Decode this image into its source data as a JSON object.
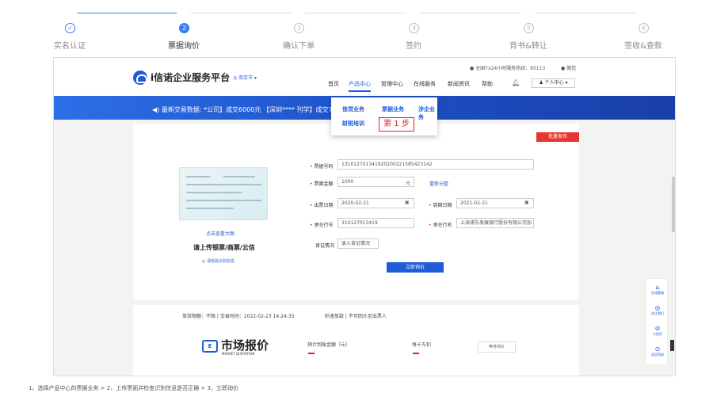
{
  "steps": [
    {
      "num": "✓",
      "label": "实名认证"
    },
    {
      "num": "2",
      "label": "票据询价"
    },
    {
      "num": "3",
      "label": "确认下单"
    },
    {
      "num": "4",
      "label": "签约"
    },
    {
      "num": "5",
      "label": "背书&转让"
    },
    {
      "num": "6",
      "label": "签收&查款"
    }
  ],
  "header": {
    "brand": "i信诺企业服务平台",
    "city": "◎ 南京市 ▾",
    "hotline": "● 全国7x24小时服务热线：95113",
    "wechat": "● 微信",
    "nav": [
      "首页",
      "产品中心",
      "管理中心",
      "在线服务",
      "新闻资讯",
      "帮助"
    ],
    "user": "♟ 个人中心 ▾"
  },
  "banner": {
    "text": "◀) 最新交易数据:      *公司】成交6000元      【深圳****                                                    刊学】成交7000元      【福建****"
  },
  "dropdown": {
    "items": [
      "信贷业务",
      "票据业务",
      "涉企业务",
      "财税培训"
    ]
  },
  "annotation": {
    "step": "第 1 步"
  },
  "form": {
    "batch_tag": "批量发布",
    "view_large": "点击查看大图",
    "upload_label": "请上传银票/商票/云信",
    "check_info": "◎ 请检验识别信息",
    "bill_no_label": "票据号码",
    "bill_no": "131012701341920200221585423142",
    "amount_label": "票面金额",
    "amount": "1000",
    "amount_unit": "元",
    "fill_link": "重新元整",
    "issue_label": "出票日期",
    "issue_date": "2020-02-21",
    "due_label": "到期日期",
    "due_date": "2021-02-21",
    "bank_no_label": "承兑行号",
    "bank_no": "310127013419",
    "bank_name_label": "承兑行名",
    "bank_name": "上海浦东发展银行股份有限公司加",
    "endorse_label": "背证情况",
    "endorse_btn": "录入背证情况",
    "submit": "立即询价"
  },
  "info": {
    "line": "单张限额：不限 | 交易时间：2022-02-23 14:24:35",
    "restrict": "秒速放款  |  不可回头至出票人",
    "market_title": "市场报价",
    "market_sub": "MARKET QUOTATION",
    "col1": "预计到账金额（元）",
    "col2": "每十万扣",
    "wait": "等待询价"
  },
  "float": [
    "在线客服",
    "关注我们",
    "小程序",
    "返回顶部"
  ],
  "footer": "1、选择产品中心的票据业务 > 2、上传票面并检查识别信息是否正确 > 3、立即询价"
}
